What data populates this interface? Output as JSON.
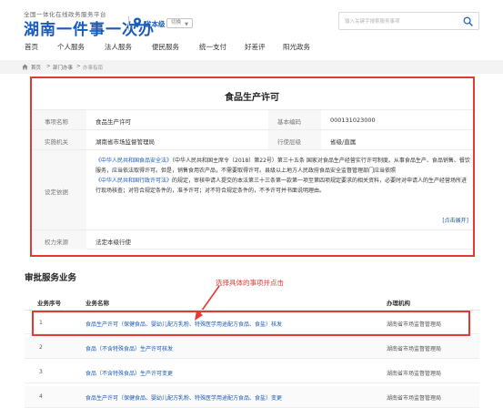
{
  "header": {
    "logo_small": "全国一体化在线政务服务平台",
    "logo_big": "湖南一件事一次办",
    "location": "省本级",
    "switch_label": "切换",
    "search_placeholder": "输入关键字搜索服务事项"
  },
  "nav": {
    "items": [
      "首页",
      "个人服务",
      "法人服务",
      "便民服务",
      "统一支付",
      "好差评",
      "阳光政务"
    ]
  },
  "breadcrumb": {
    "items": [
      "首页",
      "部门办事",
      "办事指南"
    ]
  },
  "detail": {
    "title": "食品生产许可",
    "rows": {
      "item_name_label": "事项名称",
      "item_name_value": "食品生产许可",
      "code_label": "基本编码",
      "code_value": "000131023000",
      "agency_label": "实施机关",
      "agency_value": "湖南省市场监督管理局",
      "level_label": "行使层级",
      "level_value": "省级/直属",
      "basis_label": "设定依据",
      "basis_link1": "《中华人民共和国食品安全法》",
      "basis_text1": "（中华人民共和国主席令〔2018〕第22号）第三十五条 国家对食品生产经营实行许可制度。从事食品生产、食品销售、餐饮服务，应当依法取得许可。但是，销售食用农产品，不需要取得许可。县级以上地方人民政府食品安全监督管理部门应当依照",
      "basis_link2": "《中华人民共和国行政许可法》",
      "basis_text2": "的规定，审核申请人提交的本法第三十三条第一款第一项至第四项规定要求的相关资料，必要时对申请人的生产经营场所进行现场核查；对符合规定条件的，准予许可；对不符合规定条件的，不予许可并书面说明理由。",
      "expand_label": "[点击展开]",
      "source_label": "权力来源",
      "source_value": "法定本级行使"
    }
  },
  "services": {
    "section_title": "审批服务业务",
    "annotation": "选择具体的事项并点击",
    "headers": {
      "num": "业务序号",
      "name": "业务名称",
      "org": "办理机构"
    },
    "rows": [
      {
        "num": "1",
        "name": "食品生产许可（保健食品、婴幼儿配方乳粉、特殊医学用途配方食品、食盐）核发",
        "org": "湖南省市场监督管理局"
      },
      {
        "num": "2",
        "name": "食品（不含特殊食品）生产许可核发",
        "org": "湖南省市场监督管理局"
      },
      {
        "num": "3",
        "name": "食品（不含特殊食品）生产许可变更",
        "org": "湖南省市场监督管理局"
      },
      {
        "num": "4",
        "name": "食品生产许可（保健食品、婴幼儿配方乳粉、特殊医学用途配方食品、食盐）变更",
        "org": "湖南省市场监督管理局"
      }
    ]
  },
  "colors": {
    "brand_blue": "#1a5bb8",
    "highlight_red": "#e53935"
  }
}
